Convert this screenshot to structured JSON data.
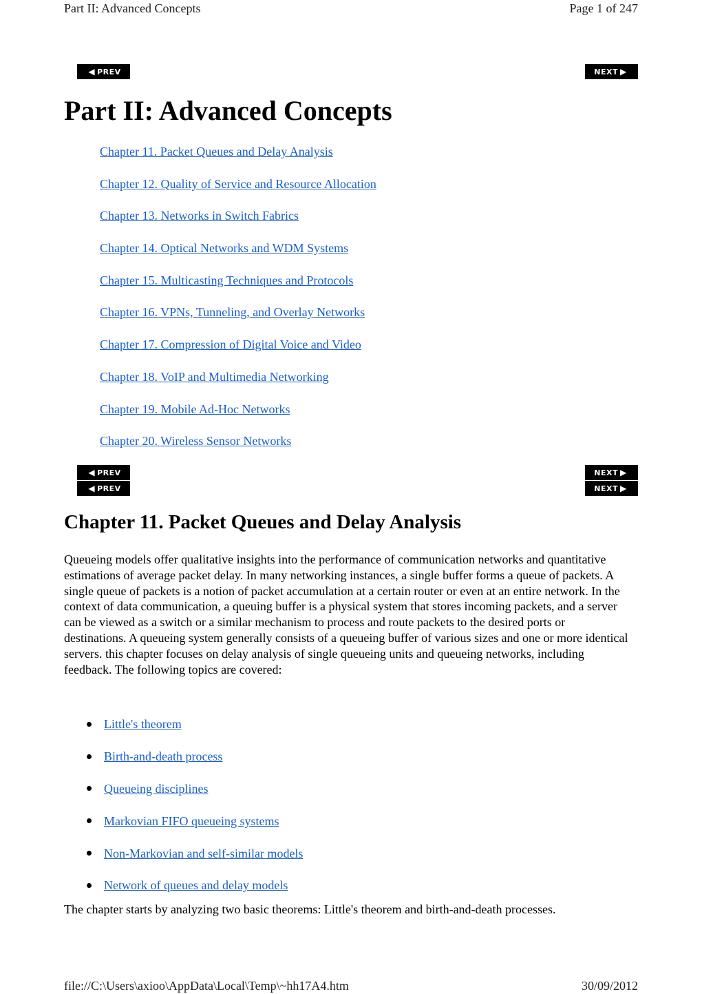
{
  "header": {
    "title": "Part II:  Advanced Concepts",
    "page_indicator": "Page 1 of 247"
  },
  "nav": {
    "prev_label": "PREV",
    "next_label": "NEXT",
    "prev_icon": "arrow-left-icon",
    "next_icon": "arrow-right-icon"
  },
  "part": {
    "title": "Part II: Advanced Concepts",
    "chapters": [
      "Chapter 11.  Packet Queues and Delay Analysis",
      "Chapter 12.  Quality of Service and Resource Allocation",
      "Chapter 13.  Networks in Switch Fabrics",
      "Chapter 14.  Optical Networks and WDM Systems",
      "Chapter 15.  Multicasting Techniques and Protocols",
      "Chapter 16.  VPNs, Tunneling, and Overlay Networks",
      "Chapter 17.  Compression of Digital Voice and Video",
      "Chapter 18.  VoIP and Multimedia Networking",
      "Chapter 19.  Mobile Ad-Hoc Networks",
      "Chapter 20.  Wireless Sensor Networks"
    ]
  },
  "chapter": {
    "title": "Chapter 11. Packet Queues and Delay Analysis",
    "intro": "Queueing models offer qualitative insights into the performance of communication networks and quantitative estimations of average packet delay. In many networking instances, a single buffer forms a queue of packets. A single queue of packets is a notion of packet accumulation at a certain router or even at an entire network. In the context of data communication, a queuing buffer is a physical system that stores incoming packets, and a server can be viewed as a switch or a similar mechanism to process and route packets to the desired ports or destinations. A queueing system generally consists of a queueing buffer of various sizes and one or more identical servers. this chapter focuses on delay analysis of single queueing units and queueing networks, including feedback. The following topics are covered:",
    "topics": [
      "Little's theorem",
      "Birth-and-death process",
      "Queueing disciplines",
      "Markovian FIFO queueing systems",
      "Non-Markovian and self-similar models",
      "Network of queues and delay models"
    ],
    "closing": "The chapter starts by analyzing two basic theorems: Little's theorem and birth-and-death processes."
  },
  "footer": {
    "path": "file://C:\\Users\\axioo\\AppData\\Local\\Temp\\~hh17A4.htm",
    "date": "30/09/2012"
  },
  "colors": {
    "link": "#1a5fc8",
    "nav_button_bg": "#000000",
    "nav_button_text": "#ffffff"
  }
}
